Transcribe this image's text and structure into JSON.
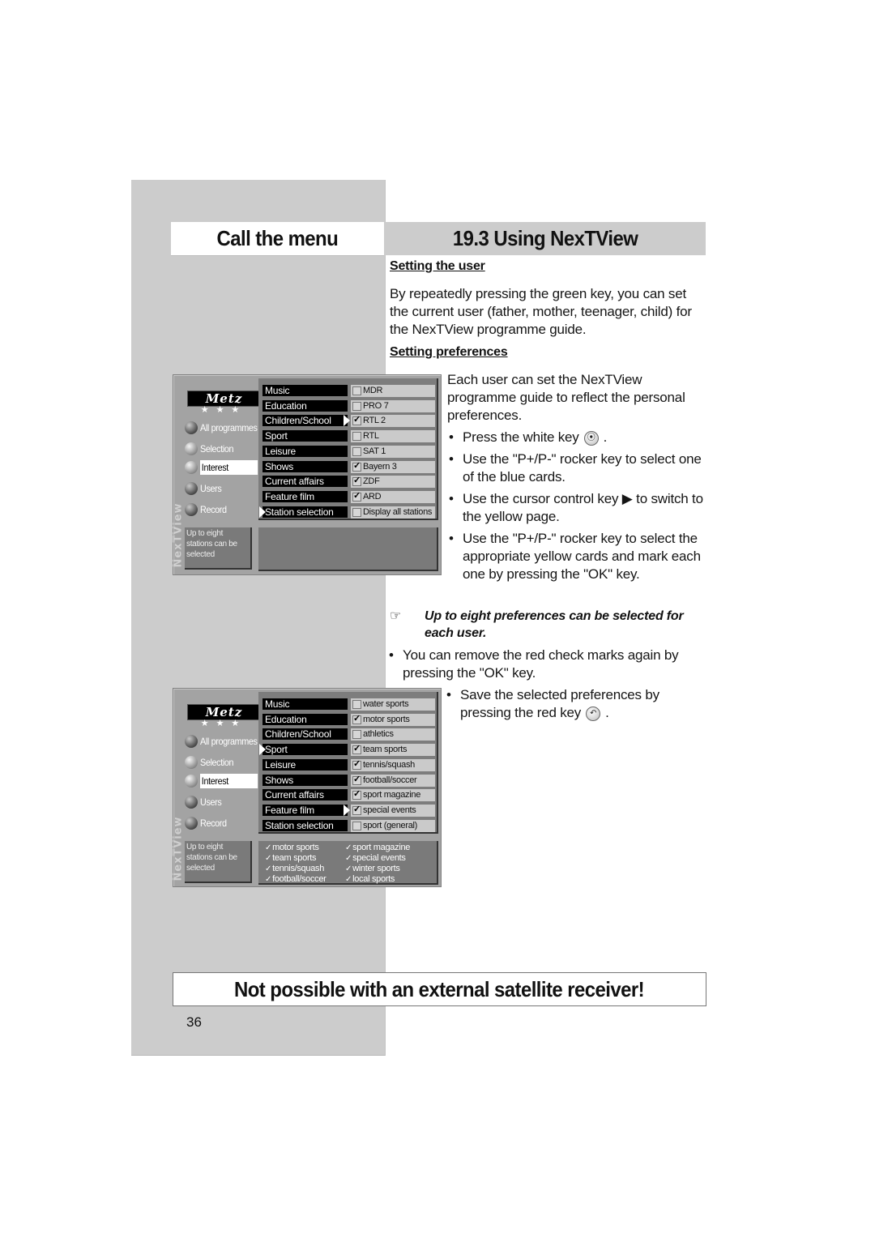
{
  "header": {
    "left_title": "Call the menu",
    "right_title": "19.3 Using NexTView"
  },
  "sections": {
    "setting_user": {
      "heading": "Setting the user",
      "text": "By repeatedly pressing the green key, you can set the current user (father, mother, teenager, child) for the NexTView programme guide."
    },
    "setting_preferences": {
      "heading": "Setting preferences",
      "intro": "Each user can set the NexTView programme guide to reflect the personal preferences.",
      "bullets": [
        {
          "text": "Press the white key",
          "icon": "antenna-key-icon",
          "icon_glyph": "⦿",
          "after": "."
        },
        {
          "text": "Use the \"P+/P-\" rocker key to select one of the blue cards."
        },
        {
          "text": "Use the cursor control key ▶ to switch to the yellow page."
        },
        {
          "text": "Use the \"P+/P-\" rocker key to select the appropriate yellow cards and mark each one by pressing the \"OK\" key."
        }
      ],
      "note_icon": "☞",
      "note": "Up to eight preferences can be selected for each user.",
      "bullets_after": [
        {
          "text": "You can remove the red check marks again by pressing the \"OK\" key."
        },
        {
          "text": "Save the selected preferences by pressing the red key",
          "icon": "return-key-icon",
          "icon_glyph": "↶",
          "after": "."
        }
      ]
    }
  },
  "tv_screens": [
    {
      "logo": "Metz",
      "stars": "★★★",
      "vertical_label": "NexTView",
      "nav": [
        {
          "label": "All programmes",
          "active": false,
          "dark": true
        },
        {
          "label": "Selection",
          "active": false,
          "dark": false
        },
        {
          "label": "Interest",
          "active": true,
          "dark": false
        },
        {
          "label": "Users",
          "active": false,
          "dark": true
        },
        {
          "label": "Record",
          "active": false,
          "dark": true
        }
      ],
      "info": "Up to eight stations can be selected",
      "categories": [
        "Music",
        "Education",
        "Children/School",
        "Sport",
        "Leisure",
        "Shows",
        "Current affairs",
        "Feature film",
        "Station selection"
      ],
      "options": [
        {
          "label": "MDR",
          "checked": false
        },
        {
          "label": "PRO 7",
          "checked": false
        },
        {
          "label": "RTL 2",
          "checked": true
        },
        {
          "label": "RTL",
          "checked": false
        },
        {
          "label": "SAT 1",
          "checked": false
        },
        {
          "label": "Bayern 3",
          "checked": true
        },
        {
          "label": "ZDF",
          "checked": true
        },
        {
          "label": "ARD",
          "checked": true
        },
        {
          "label": "Display all stations",
          "checked": false
        }
      ],
      "selected_category": "Station selection",
      "selected_option": "RTL 2",
      "summary_left": [],
      "summary_right": []
    },
    {
      "logo": "Metz",
      "stars": "★★★",
      "vertical_label": "NexTView",
      "nav": [
        {
          "label": "All programmes",
          "active": false,
          "dark": true
        },
        {
          "label": "Selection",
          "active": false,
          "dark": false
        },
        {
          "label": "Interest",
          "active": true,
          "dark": false
        },
        {
          "label": "Users",
          "active": false,
          "dark": true
        },
        {
          "label": "Record",
          "active": false,
          "dark": true
        }
      ],
      "info": "Up to eight stations can be selected",
      "categories": [
        "Music",
        "Education",
        "Children/School",
        "Sport",
        "Leisure",
        "Shows",
        "Current affairs",
        "Feature film",
        "Station selection"
      ],
      "options": [
        {
          "label": "water sports",
          "checked": false
        },
        {
          "label": "motor sports",
          "checked": true
        },
        {
          "label": "athletics",
          "checked": false
        },
        {
          "label": "team sports",
          "checked": true
        },
        {
          "label": "tennis/squash",
          "checked": true
        },
        {
          "label": "football/soccer",
          "checked": true
        },
        {
          "label": "sport magazine",
          "checked": true
        },
        {
          "label": "special events",
          "checked": true
        },
        {
          "label": "sport (general)",
          "checked": false
        }
      ],
      "selected_category": "Sport",
      "selected_option": "special events",
      "summary_left": [
        "motor sports",
        "team sports",
        "tennis/squash",
        "football/soccer"
      ],
      "summary_right": [
        "sport magazine",
        "special events",
        "winter sports",
        "local sports"
      ]
    }
  ],
  "warning": "Not possible with an external satellite receiver!",
  "page_number": "36"
}
